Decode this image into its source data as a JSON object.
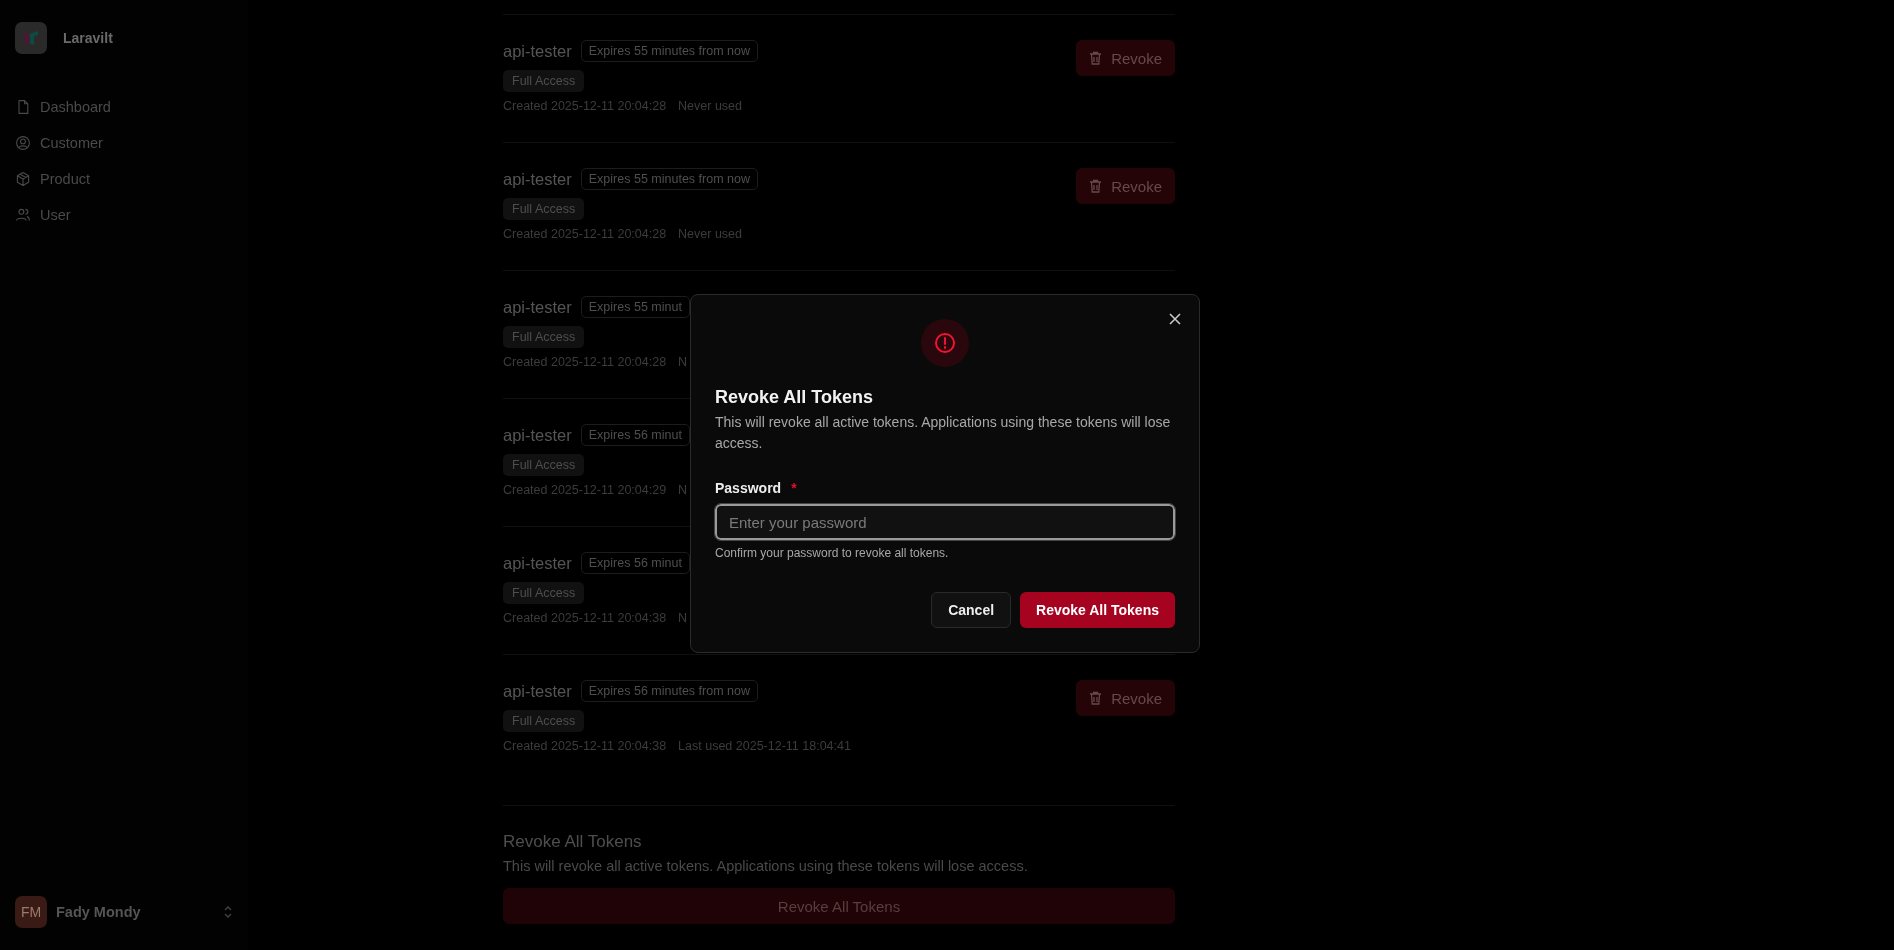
{
  "sidebar": {
    "brand": "Laravilt",
    "items": [
      {
        "label": "Dashboard"
      },
      {
        "label": "Customer"
      },
      {
        "label": "Product"
      },
      {
        "label": "User"
      }
    ],
    "user": {
      "initials": "FM",
      "name": "Fady Mondy"
    }
  },
  "tokens": [
    {
      "name": "api-tester",
      "expires": "Expires 55 minutes from now",
      "ability": "Full Access",
      "created": "Created 2025-12-11 20:04:28",
      "usage": "Never used",
      "revoke_label": "Revoke"
    },
    {
      "name": "api-tester",
      "expires": "Expires 55 minutes from now",
      "ability": "Full Access",
      "created": "Created 2025-12-11 20:04:28",
      "usage": "Never used",
      "revoke_label": "Revoke"
    },
    {
      "name": "api-tester",
      "expires": "Expires 55 minut",
      "ability": "Full Access",
      "created": "Created 2025-12-11 20:04:28",
      "usage": "N"
    },
    {
      "name": "api-tester",
      "expires": "Expires 56 minut",
      "ability": "Full Access",
      "created": "Created 2025-12-11 20:04:29",
      "usage": "N"
    },
    {
      "name": "api-tester",
      "expires": "Expires 56 minut",
      "ability": "Full Access",
      "created": "Created 2025-12-11 20:04:38",
      "usage": "N"
    },
    {
      "name": "api-tester",
      "expires": "Expires 56 minutes from now",
      "ability": "Full Access",
      "created": "Created 2025-12-11 20:04:38",
      "usage": "Last used 2025-12-11 18:04:41",
      "revoke_label": "Revoke"
    }
  ],
  "revoke_all_section": {
    "title": "Revoke All Tokens",
    "description": "This will revoke all active tokens. Applications using these tokens will lose access.",
    "button": "Revoke All Tokens"
  },
  "dialog": {
    "title": "Revoke All Tokens",
    "description": "This will revoke all active tokens. Applications using these tokens will lose access.",
    "field": {
      "label": "Password",
      "required_mark": "*",
      "placeholder": "Enter your password"
    },
    "hint": "Confirm your password to revoke all tokens.",
    "buttons": [
      {
        "label": "Cancel",
        "kind": "secondary"
      },
      {
        "label": "Revoke All Tokens",
        "kind": "danger"
      }
    ]
  }
}
